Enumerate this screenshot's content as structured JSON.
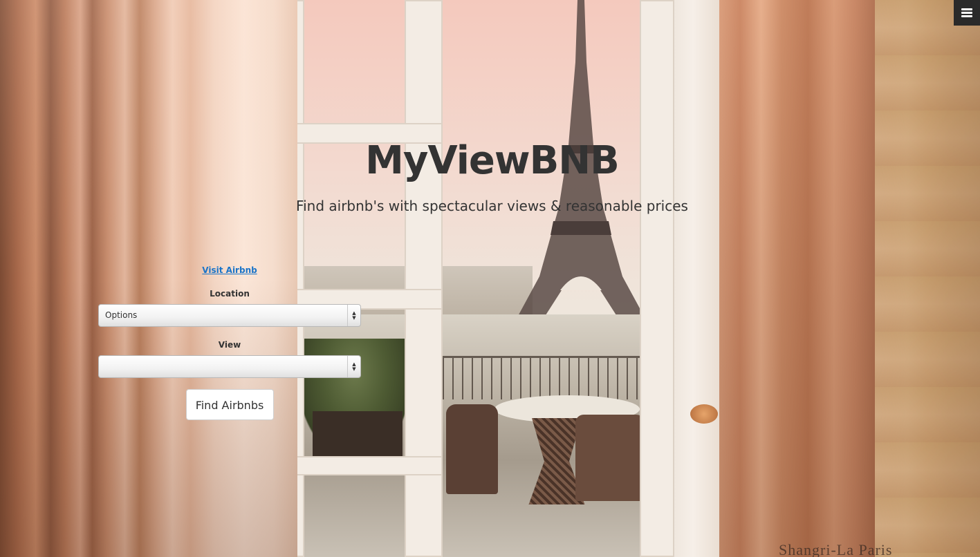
{
  "nav": {
    "menu_icon": "hamburger-menu-icon"
  },
  "hero": {
    "title": "MyViewBNB",
    "subtitle": "Find airbnb's with spectacular views & reasonable prices"
  },
  "form": {
    "visit_link": "Visit Airbnb",
    "location_label": "Location",
    "location_value": "Options",
    "view_label": "View",
    "view_value": "",
    "submit_label": "Find Airbnbs"
  },
  "background": {
    "watermark": "Shangri-La Paris"
  },
  "colors": {
    "heading_text": "#333333",
    "link": "#1a74c8",
    "menu_button_bg": "#2a2a2a"
  }
}
